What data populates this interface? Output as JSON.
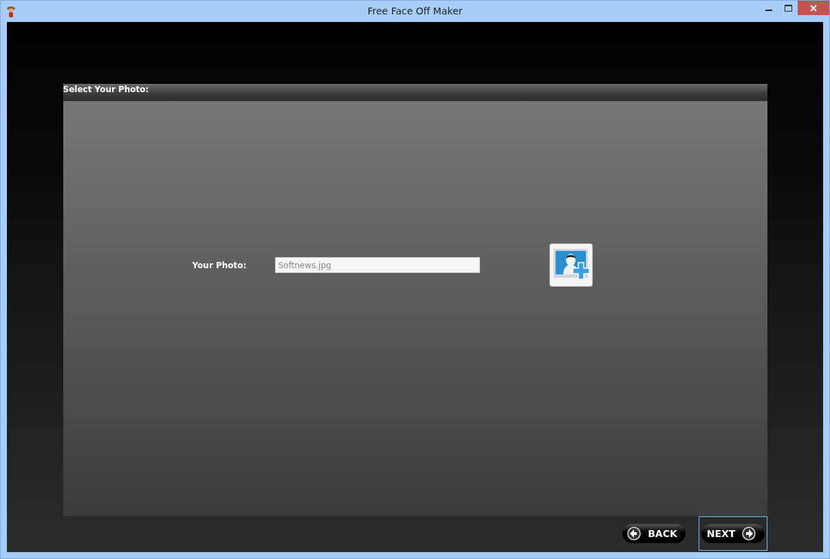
{
  "window": {
    "title": "Free Face Off Maker"
  },
  "panel": {
    "title": "Select Your Photo:",
    "photo_label": "Your Photo:",
    "photo_field": {
      "value": "Softnews.jpg"
    }
  },
  "buttons": [
    {
      "label": "BACK",
      "kind": "back",
      "focused": false
    },
    {
      "label": "NEXT",
      "kind": "next",
      "focused": true
    }
  ]
}
